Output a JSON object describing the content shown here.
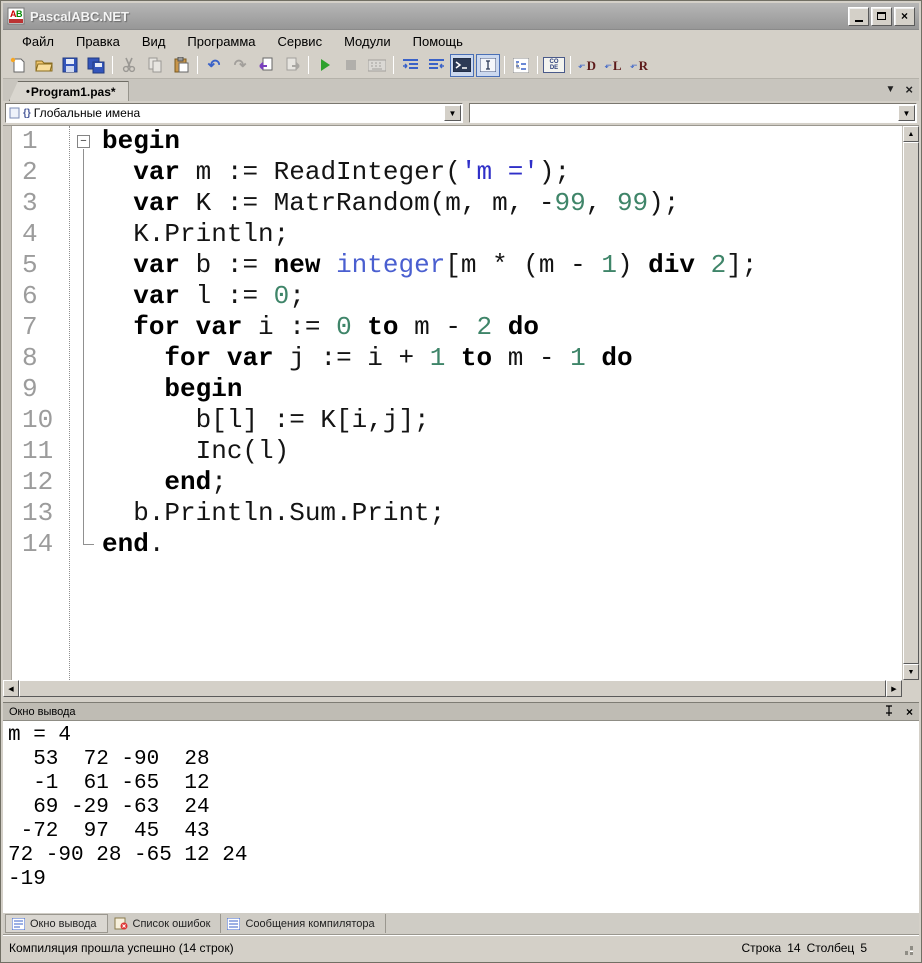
{
  "window": {
    "title": "PascalABC.NET"
  },
  "menu": {
    "items": [
      "Файл",
      "Правка",
      "Вид",
      "Программа",
      "Сервис",
      "Модули",
      "Помощь"
    ]
  },
  "toolbar": {
    "code_label": "CO DE",
    "d_label": "D",
    "l_label": "L",
    "r_label": "R",
    "icons": [
      "new-file",
      "open-folder",
      "save",
      "save-all",
      "cut",
      "copy",
      "paste",
      "undo",
      "redo",
      "navigate-back",
      "navigate-forward",
      "run",
      "stop",
      "keyboard",
      "indent",
      "outdent",
      "console-toggle",
      "text-window-toggle",
      "outline",
      "code-templates",
      "goto-definition",
      "goto-declaration",
      "find-references"
    ]
  },
  "tabstrip": {
    "dot": "•",
    "label": "Program1.pas*"
  },
  "navigator": {
    "scope_icon": "{}",
    "scope_label": "Глобальные имена"
  },
  "editor": {
    "lines": [
      {
        "seg": [
          [
            "k",
            "begin"
          ]
        ]
      },
      {
        "seg": [
          [
            "p",
            "  "
          ],
          [
            "k",
            "var"
          ],
          [
            "p",
            " m := ReadInteger("
          ],
          [
            "s",
            "'m ='"
          ],
          [
            "p",
            ");"
          ]
        ]
      },
      {
        "seg": [
          [
            "p",
            "  "
          ],
          [
            "k",
            "var"
          ],
          [
            "p",
            " K := MatrRandom(m, m, -"
          ],
          [
            "n",
            "99"
          ],
          [
            "p",
            ", "
          ],
          [
            "n",
            "99"
          ],
          [
            "p",
            ");"
          ]
        ]
      },
      {
        "seg": [
          [
            "p",
            "  K.Println;"
          ]
        ]
      },
      {
        "seg": [
          [
            "p",
            "  "
          ],
          [
            "k",
            "var"
          ],
          [
            "p",
            " b := "
          ],
          [
            "k",
            "new"
          ],
          [
            "p",
            " "
          ],
          [
            "t",
            "integer"
          ],
          [
            "p",
            "[m * (m - "
          ],
          [
            "n",
            "1"
          ],
          [
            "p",
            ") "
          ],
          [
            "k",
            "div"
          ],
          [
            "p",
            " "
          ],
          [
            "n",
            "2"
          ],
          [
            "p",
            "];"
          ]
        ]
      },
      {
        "seg": [
          [
            "p",
            "  "
          ],
          [
            "k",
            "var"
          ],
          [
            "p",
            " l := "
          ],
          [
            "n",
            "0"
          ],
          [
            "p",
            ";"
          ]
        ]
      },
      {
        "seg": [
          [
            "p",
            "  "
          ],
          [
            "k",
            "for"
          ],
          [
            "p",
            " "
          ],
          [
            "k",
            "var"
          ],
          [
            "p",
            " i := "
          ],
          [
            "n",
            "0"
          ],
          [
            "p",
            " "
          ],
          [
            "k",
            "to"
          ],
          [
            "p",
            " m - "
          ],
          [
            "n",
            "2"
          ],
          [
            "p",
            " "
          ],
          [
            "k",
            "do"
          ]
        ]
      },
      {
        "seg": [
          [
            "p",
            "    "
          ],
          [
            "k",
            "for"
          ],
          [
            "p",
            " "
          ],
          [
            "k",
            "var"
          ],
          [
            "p",
            " j := i + "
          ],
          [
            "n",
            "1"
          ],
          [
            "p",
            " "
          ],
          [
            "k",
            "to"
          ],
          [
            "p",
            " m - "
          ],
          [
            "n",
            "1"
          ],
          [
            "p",
            " "
          ],
          [
            "k",
            "do"
          ]
        ]
      },
      {
        "seg": [
          [
            "p",
            "    "
          ],
          [
            "k",
            "begin"
          ]
        ]
      },
      {
        "seg": [
          [
            "p",
            "      b[l] := K[i,j];"
          ]
        ]
      },
      {
        "seg": [
          [
            "p",
            "      Inc(l)"
          ]
        ]
      },
      {
        "seg": [
          [
            "p",
            "    "
          ],
          [
            "k",
            "end"
          ],
          [
            "p",
            ";"
          ]
        ]
      },
      {
        "seg": [
          [
            "p",
            "  b.Println.Sum.Print;"
          ]
        ]
      },
      {
        "seg": [
          [
            "k",
            "end"
          ],
          [
            "p",
            "."
          ]
        ]
      }
    ],
    "colors": {
      "keyword": "#000000",
      "string": "#2f2fc8",
      "number": "#3f8569",
      "type": "#4a5fd0",
      "line_number": "#9c9c9c"
    }
  },
  "output": {
    "title": "Окно вывода",
    "lines": [
      "m = 4",
      "  53  72 -90  28",
      "  -1  61 -65  12",
      "  69 -29 -63  24",
      " -72  97  45  43",
      "72 -90 28 -65 12 24",
      "-19"
    ]
  },
  "bottom_tabs": [
    {
      "label": "Окно вывода",
      "active": true
    },
    {
      "label": "Список ошибок",
      "active": false
    },
    {
      "label": "Сообщения компилятора",
      "active": false
    }
  ],
  "status": {
    "message": "Компиляция прошла успешно (14 строк)",
    "line_label": "Строка",
    "line_value": "14",
    "col_label": "Столбец",
    "col_value": "5"
  }
}
